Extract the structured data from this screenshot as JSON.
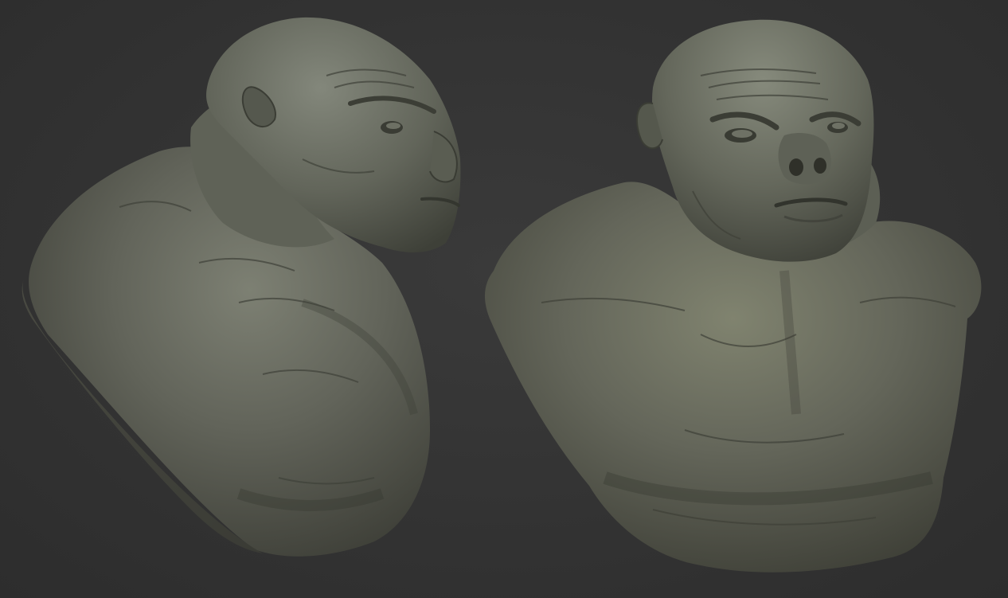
{
  "scene": {
    "background_color": "#333333",
    "sculpt_color": "#5f5f52",
    "sculpt_highlight": "#86897c",
    "sculpt_shadow": "#2f3029",
    "views": [
      {
        "name": "three-quarter-view",
        "icon": "sculpt-bust-side"
      },
      {
        "name": "front-view",
        "icon": "sculpt-bust-front"
      }
    ]
  }
}
